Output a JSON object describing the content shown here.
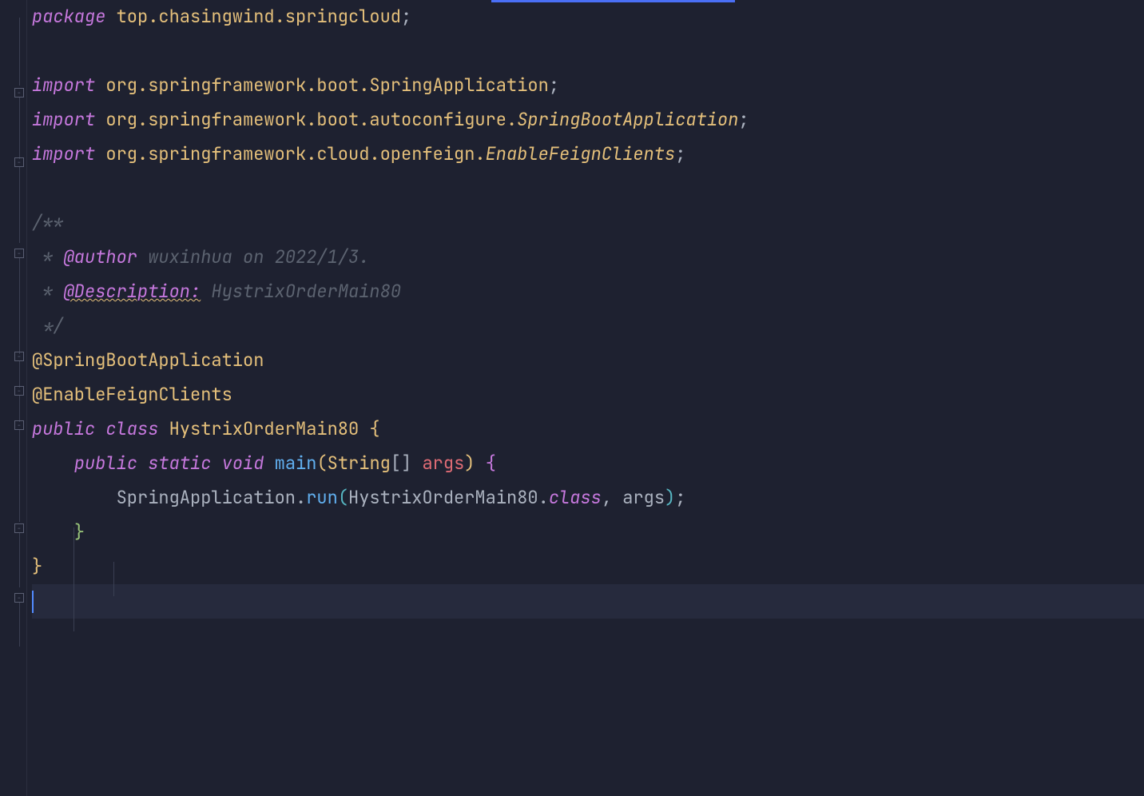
{
  "code": {
    "l1_kw": "package",
    "l1_path": " top.chasingwind.springcloud",
    "l1_semi": ";",
    "l3_kw": "import",
    "l3_path": " org.springframework.boot.SpringApplication",
    "l3_semi": ";",
    "l4_kw": "import",
    "l4_path1": " org.springframework.boot.autoconfigure.",
    "l4_path2": "SpringBootApplication",
    "l4_semi": ";",
    "l5_kw": "import",
    "l5_path1": " org.springframework.cloud.openfeign.",
    "l5_path2": "EnableFeignClients",
    "l5_semi": ";",
    "l7_c": "/**",
    "l8_star": " * ",
    "l8_tag": "@author",
    "l8_text": " wuxinhua on 2022/1/3.",
    "l9_star": " * ",
    "l9_tag": "@Description:",
    "l9_text": " HystrixOrderMain80",
    "l10_c": " */",
    "l11_ann": "@SpringBootApplication",
    "l12_ann": "@EnableFeignClients",
    "l13_kw1": "public",
    "l13_kw2": " class",
    "l13_name": " HystrixOrderMain80 ",
    "l13_brace": "{",
    "l14_indent": "    ",
    "l14_kw1": "public",
    "l14_kw2": " static",
    "l14_kw3": " void",
    "l14_method": " main",
    "l14_po": "(",
    "l14_ptype": "String",
    "l14_arr": "[] ",
    "l14_pname": "args",
    "l14_pc": ")",
    "l14_sp": " ",
    "l14_brace": "{",
    "l15_indent": "        ",
    "l15_cls": "SpringApplication",
    "l15_dot": ".",
    "l15_method": "run",
    "l15_po": "(",
    "l15_arg1": "HystrixOrderMain80",
    "l15_dot2": ".",
    "l15_kw": "class",
    "l15_comma": ", args",
    "l15_pc": ")",
    "l15_semi": ";",
    "l16_indent": "    ",
    "l16_brace": "}",
    "l17_brace": "}"
  }
}
